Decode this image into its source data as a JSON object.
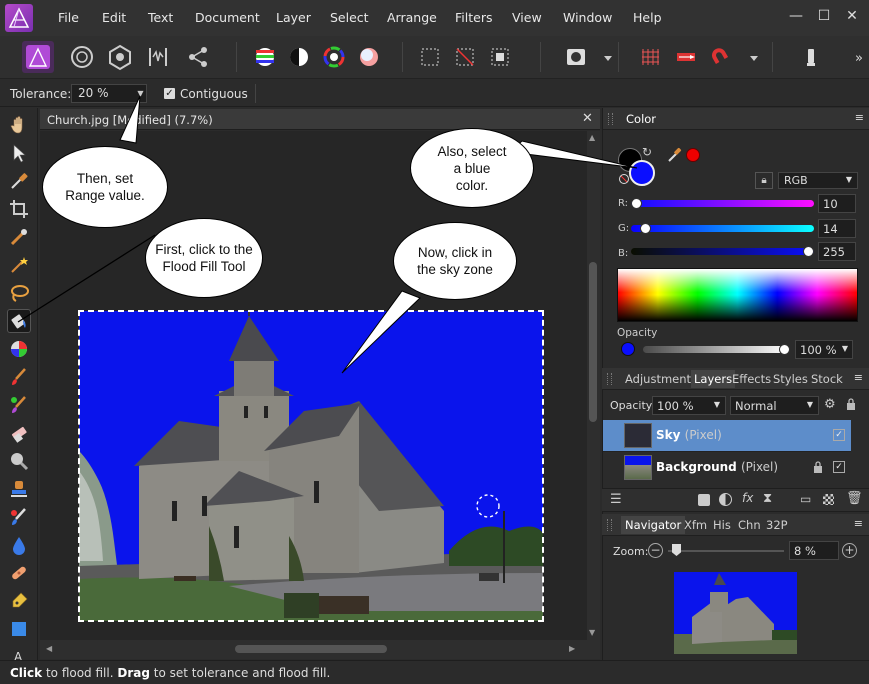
{
  "menu": [
    "File",
    "Edit",
    "Text",
    "Document",
    "Layer",
    "Select",
    "Arrange",
    "Filters",
    "View",
    "Window",
    "Help"
  ],
  "window_controls": {
    "minimize": "—",
    "maximize": "☐",
    "close": "✕"
  },
  "context_toolbar": {
    "tolerance_label": "Tolerance:",
    "tolerance_value": "20 %",
    "contiguous_label": "Contiguous",
    "contiguous_checked": true
  },
  "document": {
    "tab_title": "Church.jpg [Modified] (7.7%)",
    "close_glyph": "✕"
  },
  "status_bar": {
    "action1": "Click",
    "text1": " to flood fill. ",
    "action2": "Drag",
    "text2": " to set tolerance and flood fill."
  },
  "color_panel": {
    "tab": "Color",
    "model": "RGB",
    "channels": [
      {
        "label": "R:",
        "value": "10"
      },
      {
        "label": "G:",
        "value": "14"
      },
      {
        "label": "B:",
        "value": "255"
      }
    ],
    "opacity_label": "Opacity",
    "opacity_value": "100 %",
    "fill_color": "#0a0eff",
    "stroke_color": "#000000"
  },
  "layers_panel": {
    "tabs": [
      "Adjustment",
      "Layers",
      "Effects",
      "Styles",
      "Stock"
    ],
    "active_tab": "Layers",
    "opacity_label": "Opacity:",
    "opacity_value": "100 %",
    "blend_mode": "Normal",
    "layers": [
      {
        "name": "Sky",
        "type": "(Pixel)",
        "selected": true
      },
      {
        "name": "Background",
        "type": "(Pixel)",
        "selected": false,
        "locked": true
      }
    ]
  },
  "navigator_panel": {
    "tabs": [
      "Navigator",
      "Xfm",
      "His",
      "Chn",
      "32P"
    ],
    "active_tab": "Navigator",
    "zoom_label": "Zoom:",
    "zoom_value": "8 %"
  },
  "callouts": {
    "range": "Then, set\nRange value.",
    "flood": "First, click to the\nFlood Fill Tool",
    "blue": "Also, select\na blue\ncolor.",
    "sky": "Now, click in\nthe sky zone"
  }
}
